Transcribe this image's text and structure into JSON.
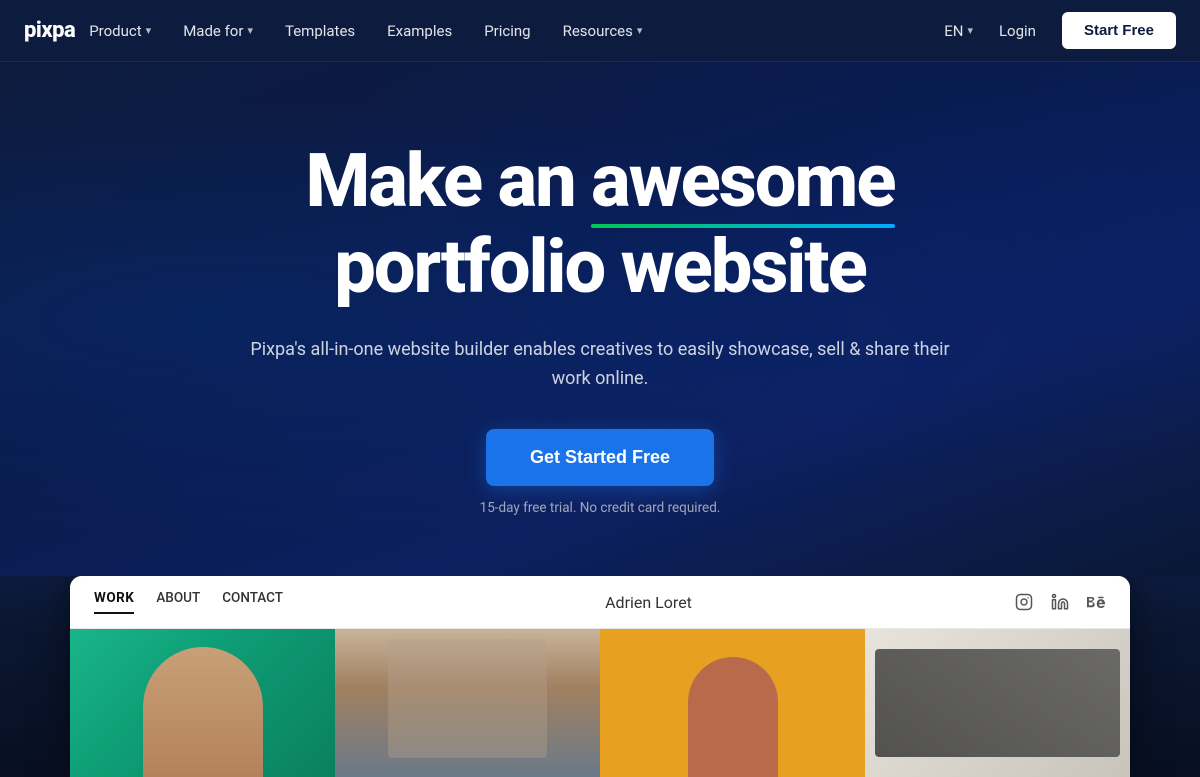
{
  "logo": {
    "text": "pixpa"
  },
  "nav": {
    "links": [
      {
        "label": "Product",
        "hasDropdown": true
      },
      {
        "label": "Made for",
        "hasDropdown": true
      },
      {
        "label": "Templates",
        "hasDropdown": false
      },
      {
        "label": "Examples",
        "hasDropdown": false
      },
      {
        "label": "Pricing",
        "hasDropdown": false
      },
      {
        "label": "Resources",
        "hasDropdown": true
      }
    ],
    "lang": "EN",
    "login_label": "Login",
    "start_free_label": "Start Free"
  },
  "hero": {
    "headline_part1": "Make an ",
    "headline_awesome": "awesome",
    "headline_part2": "portfolio website",
    "subtext": "Pixpa's all-in-one website builder enables creatives to easily showcase, sell & share their work online.",
    "cta_button": "Get Started Free",
    "trial_text": "15-day free trial. No credit card required."
  },
  "preview": {
    "nav_items": [
      {
        "label": "WORK",
        "active": true
      },
      {
        "label": "ABOUT",
        "active": false
      },
      {
        "label": "CONTACT",
        "active": false
      }
    ],
    "site_name": "Adrien Loret",
    "social_icons": [
      "instagram-icon",
      "linkedin-icon",
      "behance-icon"
    ]
  },
  "portfolio_images": [
    {
      "alt": "Portrait on teal background"
    },
    {
      "alt": "Interior photograph"
    },
    {
      "alt": "Woman on yellow background"
    },
    {
      "alt": "Product packaging design"
    }
  ]
}
